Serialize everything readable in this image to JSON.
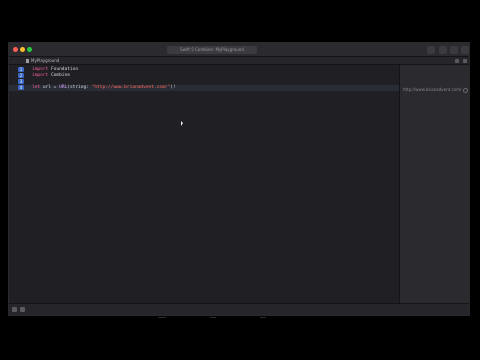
{
  "window": {
    "title": "Swift 5 Combine: MyPlayground",
    "tab_label": "MyPlayground"
  },
  "editor": {
    "lines": [
      {
        "number": "1",
        "keyword": "import",
        "rest": " Foundation"
      },
      {
        "number": "2",
        "keyword": "import",
        "rest": " Combine"
      },
      {
        "number": "3",
        "keyword": "",
        "rest": ""
      },
      {
        "number": "4",
        "keyword": "let",
        "decl": " url = ",
        "type": "URL",
        "args": "(string: ",
        "string": "\"http://www.brianadvent.com/\"",
        "end": ")!"
      }
    ]
  },
  "results": {
    "line4": "http://www.brianadvent.com/"
  }
}
